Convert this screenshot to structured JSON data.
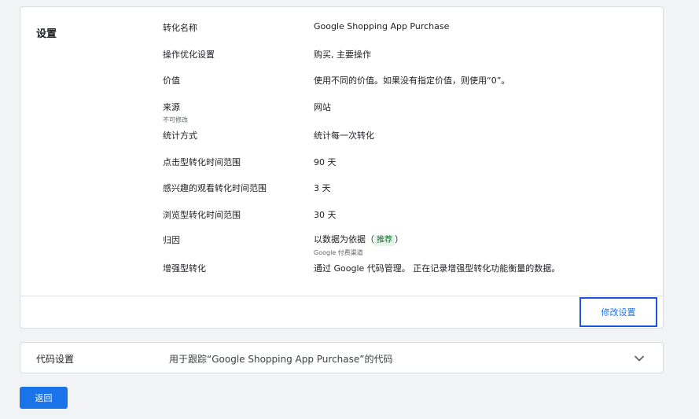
{
  "settings": {
    "title": "设置",
    "rows": [
      {
        "label": "转化名称",
        "value": "Google Shopping App Purchase"
      },
      {
        "label": "操作优化设置",
        "value": "购买, 主要操作"
      },
      {
        "label": "价值",
        "value": "使用不同的价值。如果没有指定价值，则使用“0”。"
      },
      {
        "label": "来源",
        "sublabel": "不可修改",
        "value": "网站"
      },
      {
        "label": "统计方式",
        "value": "统计每一次转化"
      },
      {
        "label": "点击型转化时间范围",
        "value": "90 天"
      },
      {
        "label": "感兴趣的观看转化时间范围",
        "value": "3 天"
      },
      {
        "label": "浏览型转化时间范围",
        "value": "30 天"
      },
      {
        "label": "归因",
        "value_prefix": "以数据为依据（",
        "badge": "推荐",
        "value_suffix": "）",
        "subvalue": "Google 付费渠道"
      },
      {
        "label": "增强型转化",
        "value": "通过 Google 代码管理。 正在记录增强型转化功能衡量的数据。"
      }
    ],
    "edit_label": "修改设置"
  },
  "code_settings": {
    "title": "代码设置",
    "description": "用于跟踪“Google Shopping App Purchase”的代码",
    "chevron_icon": "chevron-down-icon"
  },
  "back_label": "返回",
  "colors": {
    "accent": "#1a73e8",
    "badge_bg": "#e6f4ea",
    "badge_text": "#137333",
    "focus_border": "#1a56db"
  }
}
